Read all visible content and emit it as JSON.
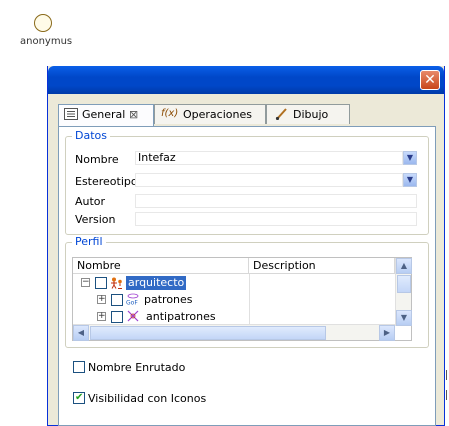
{
  "canvas": {
    "actor": {
      "label": "anonymus"
    }
  },
  "dialog": {
    "close_label": "✕",
    "tabs": [
      {
        "label": "General",
        "icon": "properties-icon",
        "active": true
      },
      {
        "label": "Operaciones",
        "icon": "function-icon",
        "active": false
      },
      {
        "label": "Dibujo",
        "icon": "brush-icon",
        "active": false
      }
    ],
    "tab_close_label": "⊠",
    "datos": {
      "title": "Datos",
      "nombre_label": "Nombre",
      "nombre_value": "Intefaz",
      "estereotipo_label": "Estereotipo",
      "estereotipo_value": "",
      "autor_label": "Autor",
      "autor_value": "",
      "version_label": "Version",
      "version_value": ""
    },
    "perfil": {
      "title": "Perfil",
      "columns": [
        "Nombre",
        "Description"
      ],
      "rows": [
        {
          "label": "arquitecto",
          "expander": "−",
          "icon": "actor-group-icon",
          "selected": true,
          "description": ""
        },
        {
          "label": "patrones",
          "expander": "+",
          "icon": "gof-icon",
          "selected": false,
          "description": ""
        },
        {
          "label": "antipatrones",
          "expander": "+",
          "icon": "antipattern-icon",
          "selected": false,
          "description": ""
        }
      ]
    },
    "options": {
      "nombre_enrutado": {
        "label": "Nombre Enrutado",
        "checked": false
      },
      "visibilidad_iconos": {
        "label": "Visibilidad con Iconos",
        "checked": true
      }
    }
  }
}
